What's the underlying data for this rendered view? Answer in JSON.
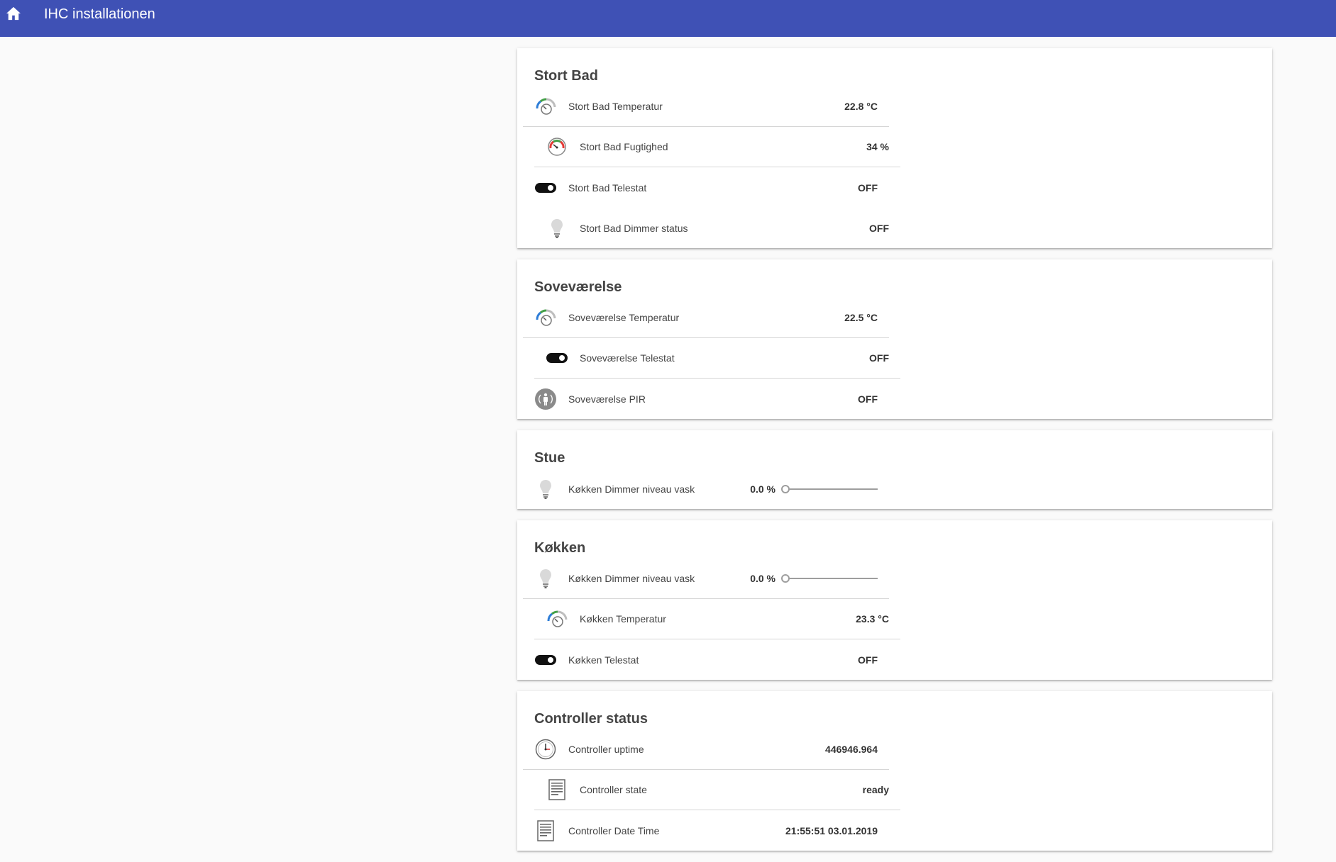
{
  "header": {
    "title": "IHC installationen",
    "icon": "home-icon"
  },
  "cards": [
    {
      "title": "Stort Bad",
      "rows": [
        {
          "icon": "thermometer-gauge-icon",
          "label": "Stort Bad Temperatur",
          "value": "22.8 °C"
        },
        {
          "icon": "humidity-gauge-icon",
          "label": "Stort Bad Fugtighed",
          "value": "34 %"
        },
        {
          "icon": "toggle-icon",
          "label": "Stort Bad Telestat",
          "value": "OFF"
        },
        {
          "icon": "lightbulb-icon",
          "label": "Stort Bad Dimmer status",
          "value": "OFF"
        }
      ]
    },
    {
      "title": "Soveværelse",
      "rows": [
        {
          "icon": "thermometer-gauge-icon",
          "label": "Soveværelse Temperatur",
          "value": "22.5 °C"
        },
        {
          "icon": "toggle-icon",
          "label": "Soveværelse Telestat",
          "value": "OFF"
        },
        {
          "icon": "motion-sensor-icon",
          "label": "Soveværelse PIR",
          "value": "OFF"
        }
      ]
    },
    {
      "title": "Stue",
      "rows": [
        {
          "icon": "lightbulb-icon",
          "label": "Køkken Dimmer niveau vask",
          "value": "0.0 %",
          "slider": 0
        }
      ]
    },
    {
      "title": "Køkken",
      "rows": [
        {
          "icon": "lightbulb-icon",
          "label": "Køkken Dimmer niveau vask",
          "value": "0.0 %",
          "slider": 0
        },
        {
          "icon": "thermometer-gauge-icon",
          "label": "Køkken Temperatur",
          "value": "23.3 °C"
        },
        {
          "icon": "toggle-icon",
          "label": "Køkken Telestat",
          "value": "OFF"
        }
      ]
    },
    {
      "title": "Controller status",
      "rows": [
        {
          "icon": "clock-icon",
          "label": "Controller uptime",
          "value": "446946.964"
        },
        {
          "icon": "document-icon",
          "label": "Controller state",
          "value": "ready"
        },
        {
          "icon": "document-icon",
          "label": "Controller Date Time",
          "value": "21:55:51 03.01.2019"
        }
      ]
    }
  ]
}
